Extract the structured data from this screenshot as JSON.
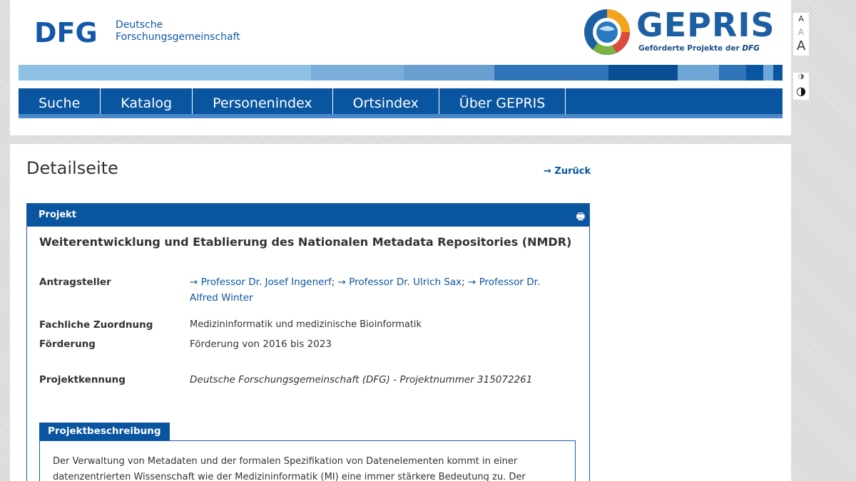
{
  "header": {
    "dfg_logo_text": "DFG",
    "dfg_name_line1": "Deutsche",
    "dfg_name_line2": "Forschungsgemeinschaft",
    "gepris_wordmark": "GEPRIS",
    "gepris_tagline": "Geförderte Projekte der",
    "gepris_tagline_brand": "DFG",
    "stripe_colors": [
      "#8fc0e6",
      "#7aaedb",
      "#6a9fd3",
      "#2f73b8",
      "#0a4f94",
      "#6fa6d8",
      "#2f73b8",
      "#0a55a0",
      "#6fa6d8",
      "#0a55a0"
    ]
  },
  "nav": {
    "items": [
      "Suche",
      "Katalog",
      "Personenindex",
      "Ortsindex",
      "Über GEPRIS"
    ]
  },
  "tools": {
    "font_small": "A",
    "font_medium": "A",
    "font_large": "A",
    "contrast_small": "◑",
    "contrast_large": "◑"
  },
  "page": {
    "title": "Detailseite",
    "back_link": "→ Zurück"
  },
  "project": {
    "section_label": "Projekt",
    "print_icon": "printer-icon",
    "title": "Weiterentwicklung und Etablierung des Nationalen Metadata Repositories (NMDR)",
    "applicants_label": "Antragsteller",
    "applicants": [
      "Professor Dr. Josef Ingenerf",
      "Professor Dr. Ulrich Sax",
      "Professor Dr. Alfred Winter"
    ],
    "subject_label": "Fachliche Zuordnung",
    "subject": "Medizininformatik und medizinische Bioinformatik",
    "funding_label": "Förderung",
    "funding": "Förderung von 2016 bis 2023",
    "id_label": "Projektkennung",
    "id_value": "Deutsche Forschungsgemeinschaft (DFG) - Projektnummer 315072261",
    "description_tab": "Projektbeschreibung",
    "description": "Der Verwaltung von Metadaten und der formalen Spezifikation von Datenelementen kommt in einer datenzentrierten Wissenschaft wie der Medizininformatik (MI) eine immer stärkere Bedeutung zu. Der"
  }
}
